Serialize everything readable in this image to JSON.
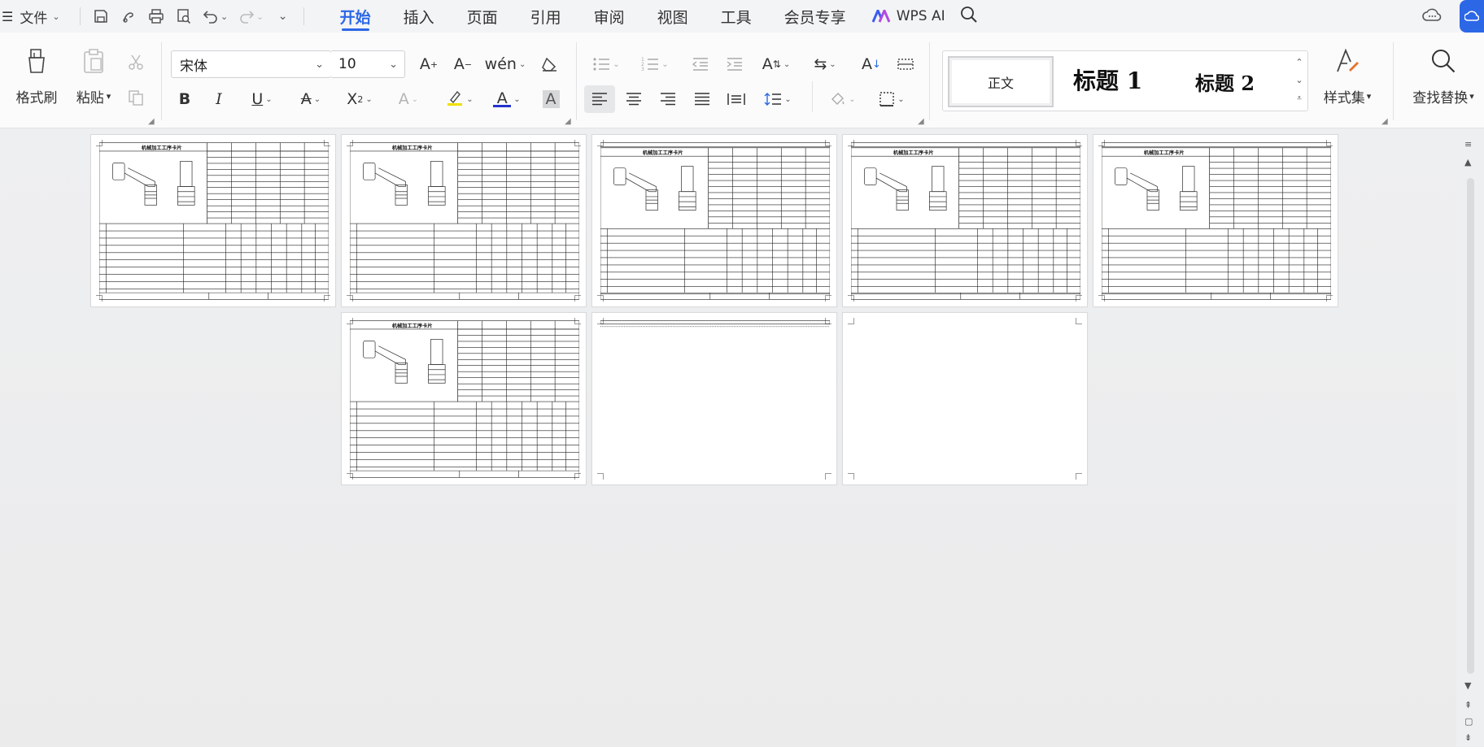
{
  "menubar": {
    "file_label": "文件",
    "tabs": [
      {
        "label": "开始",
        "active": true
      },
      {
        "label": "插入"
      },
      {
        "label": "页面"
      },
      {
        "label": "引用"
      },
      {
        "label": "审阅"
      },
      {
        "label": "视图"
      },
      {
        "label": "工具"
      },
      {
        "label": "会员专享"
      }
    ],
    "ai_label": "WPS AI"
  },
  "ribbon": {
    "format_painter": "格式刷",
    "paste": "粘贴",
    "font_name": "宋体",
    "font_size": "10",
    "styles": {
      "normal": "正文",
      "heading1": "标题 1",
      "heading2": "标题 2"
    },
    "style_set": "样式集",
    "find_replace": "查找替换"
  },
  "document": {
    "page_count": 8,
    "pages_per_row": 5,
    "thumbnail_title": "机械加工工序卡片"
  },
  "colors": {
    "accent": "#2c67e6",
    "font_color_bar": "#2233cc",
    "highlight_bar": "#f0e000"
  }
}
